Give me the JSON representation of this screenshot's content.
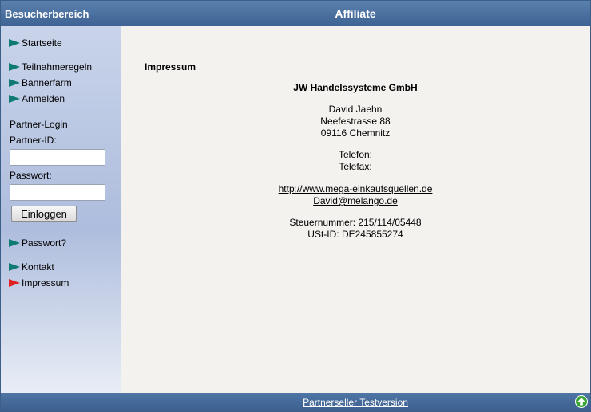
{
  "header": {
    "left_title": "Besucherbereich",
    "center_title": "Affiliate"
  },
  "sidebar": {
    "nav_top": [
      {
        "label": "Startseite",
        "active": false
      },
      {
        "label": "Teilnahmeregeln",
        "active": false
      },
      {
        "label": "Bannerfarm",
        "active": false
      },
      {
        "label": "Anmelden",
        "active": false
      }
    ],
    "login": {
      "title": "Partner-Login",
      "id_label": "Partner-ID:",
      "id_value": "",
      "password_label": "Passwort:",
      "password_value": "",
      "button_label": "Einloggen"
    },
    "nav_bottom": [
      {
        "label": "Passwort?",
        "active": false
      },
      {
        "label": "Kontakt",
        "active": false
      },
      {
        "label": "Impressum",
        "active": true
      }
    ],
    "colors": {
      "flag": "#0e7a72",
      "flag_active": "#e02020"
    }
  },
  "content": {
    "heading": "Impressum",
    "company": "JW Handelssysteme GmbH",
    "address": [
      "David Jaehn",
      "Neefestrasse 88",
      "09116 Chemnitz"
    ],
    "phone": "Telefon:",
    "fax": "Telefax:",
    "website": "http://www.mega-einkaufsquellen.de",
    "email": "David@melango.de",
    "tax": "Steuernummer: 215/114/05448",
    "vat": "USt-ID: DE245855274"
  },
  "footer": {
    "link": "Partnerseller Testversion",
    "icon": "arrow-up-icon"
  }
}
